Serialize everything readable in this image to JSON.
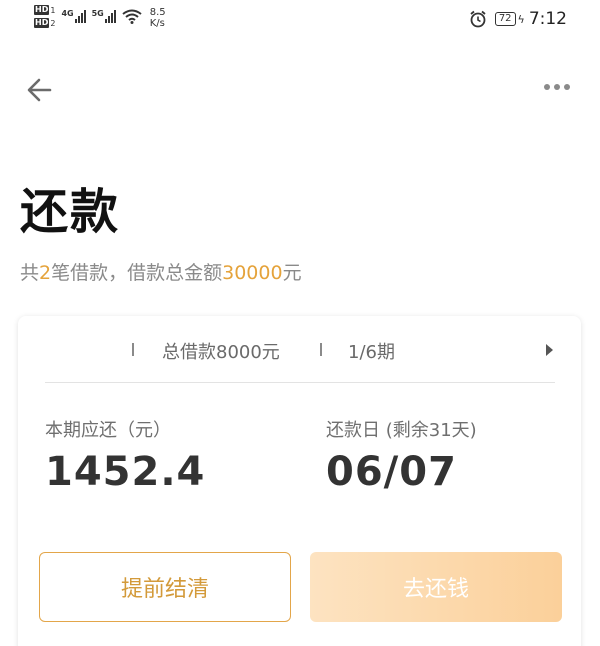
{
  "status_bar": {
    "hd1": "HD",
    "hd1_num": "1",
    "hd2": "HD",
    "hd2_num": "2",
    "signal1_label": "4G",
    "signal2_label": "5G",
    "speed_value": "8.5",
    "speed_unit": "K/s",
    "battery": "72",
    "time": "7:12"
  },
  "nav": {
    "back_icon": "arrow-left-icon",
    "more_icon": "more-dots-icon"
  },
  "page": {
    "title": "还款",
    "summary_prefix": "共",
    "summary_count": "2",
    "summary_mid": "笔借款，借款总金额",
    "summary_amount": "30000",
    "summary_suffix": "元"
  },
  "card": {
    "loan_total": "总借款8000元",
    "period": "1/6期",
    "current_label": "本期应还（元）",
    "current_amount": "1452.4",
    "due_label": "还款日 (剩余31天)",
    "due_date": "06/07",
    "early_settle_button": "提前结清",
    "pay_button": "去还钱"
  },
  "colors": {
    "accent": "#e5a33b",
    "button_gradient_start": "#fde3c1",
    "button_gradient_end": "#fbd09a"
  }
}
